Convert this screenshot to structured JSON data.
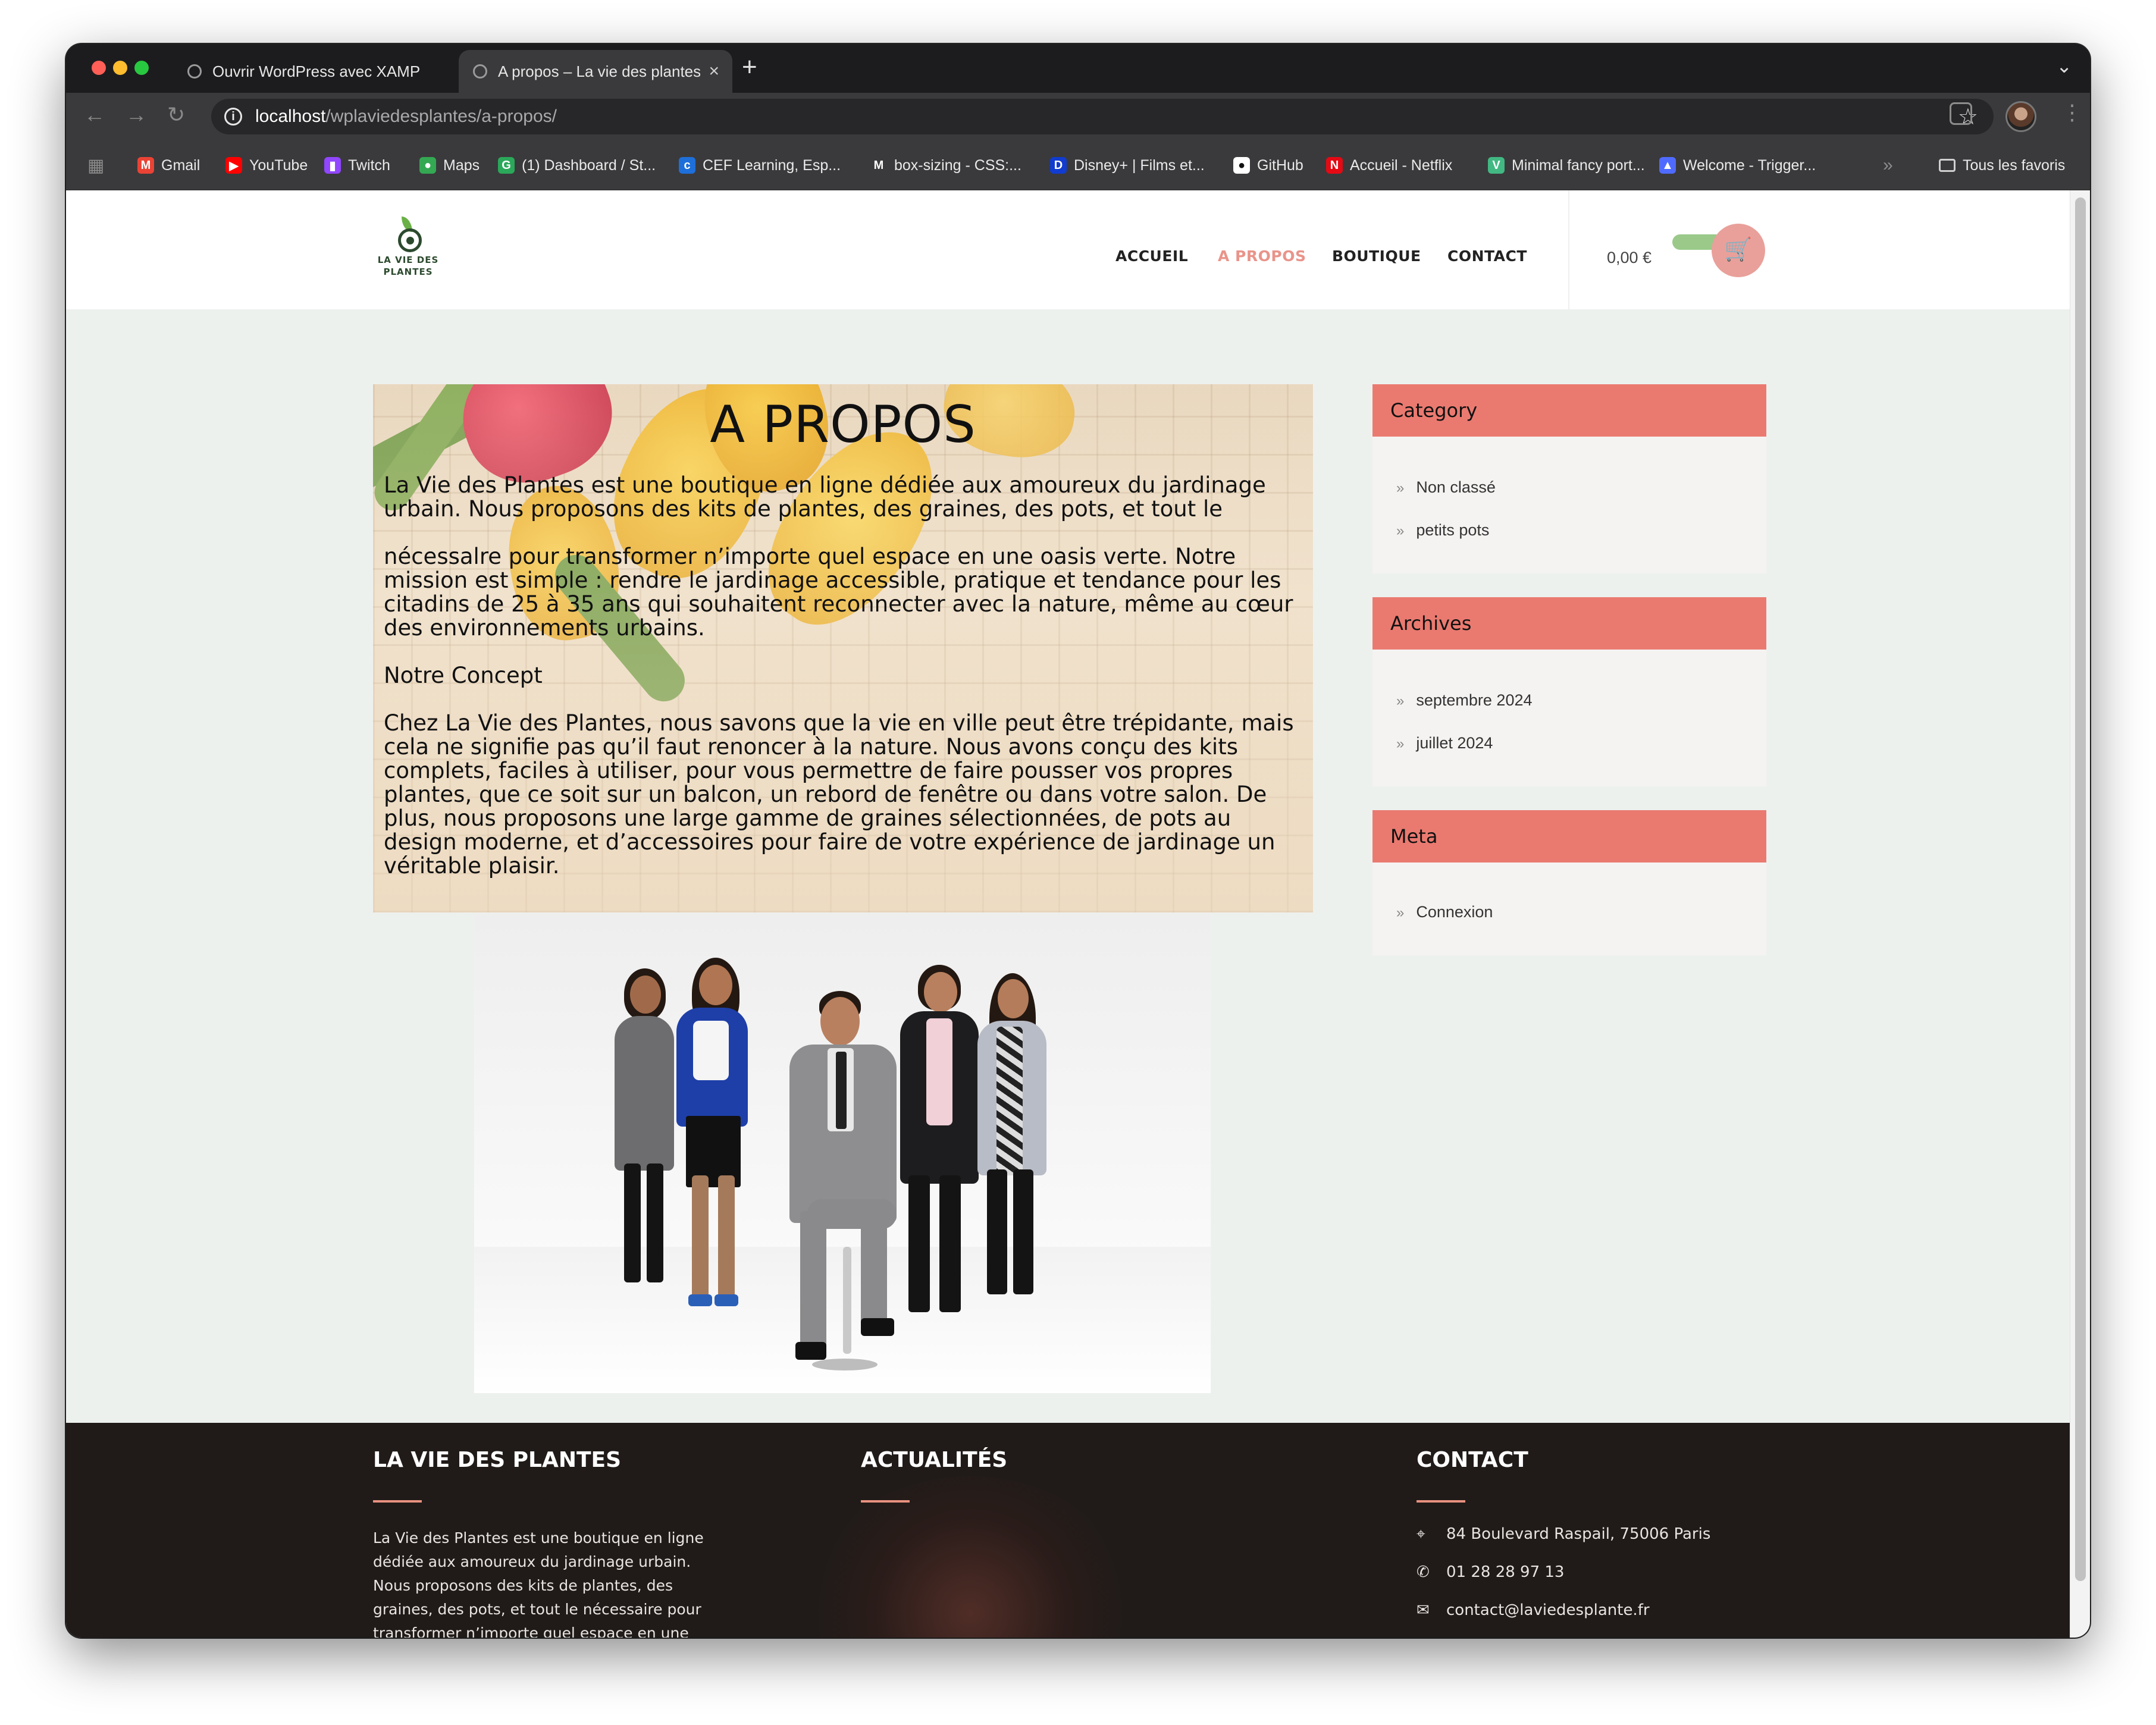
{
  "browser": {
    "tabs": [
      {
        "title": "Ouvrir WordPress avec XAMP",
        "close": "×"
      },
      {
        "title": "A propos – La vie des plantes",
        "close": "×"
      }
    ],
    "new_tab": "+",
    "tab_menu": "⌄",
    "nav": {
      "back": "←",
      "forward": "→",
      "reload": "↻"
    },
    "url": {
      "host": "localhost",
      "path": "/wplaviedesplantes/a-propos/"
    },
    "star": "☆",
    "menu": "⋮",
    "bookmarks": [
      {
        "label": "Gmail",
        "icon": "gmail-icon",
        "color": "#ea4335",
        "glyph": "M"
      },
      {
        "label": "YouTube",
        "icon": "youtube-icon",
        "color": "#ff0000",
        "glyph": "▶"
      },
      {
        "label": "Twitch",
        "icon": "twitch-icon",
        "color": "#9146ff",
        "glyph": "▮"
      },
      {
        "label": "Maps",
        "icon": "maps-icon",
        "color": "#34a853",
        "glyph": "●"
      },
      {
        "label": "(1) Dashboard / St...",
        "icon": "dashboard-icon",
        "color": "#2ba85a",
        "glyph": "G"
      },
      {
        "label": "CEF Learning, Esp...",
        "icon": "cef-icon",
        "color": "#1e6fd9",
        "glyph": "c"
      },
      {
        "label": "box-sizing - CSS:...",
        "icon": "mdn-icon",
        "color": "#3a3a3c",
        "glyph": "M"
      },
      {
        "label": "Disney+ | Films et...",
        "icon": "disney-icon",
        "color": "#113ccf",
        "glyph": "D"
      },
      {
        "label": "GitHub",
        "icon": "github-icon",
        "color": "#ffffff",
        "glyph": "●"
      },
      {
        "label": "Accueil - Netflix",
        "icon": "netflix-icon",
        "color": "#e50914",
        "glyph": "N"
      },
      {
        "label": "Minimal fancy port...",
        "icon": "vue-icon",
        "color": "#42b883",
        "glyph": "V"
      },
      {
        "label": "Welcome - Trigger...",
        "icon": "trigger-icon",
        "color": "#4f6bff",
        "glyph": "▲"
      }
    ],
    "bookmarks_overflow": "»",
    "all_bookmarks": "Tous les favoris"
  },
  "site": {
    "logo": {
      "line1": "LA VIE DES",
      "line2": "PLANTES"
    },
    "menu": [
      {
        "label": "ACCUEIL",
        "active": false
      },
      {
        "label": "A PROPOS",
        "active": true
      },
      {
        "label": "BOUTIQUE",
        "active": false
      },
      {
        "label": "CONTACT",
        "active": false
      }
    ],
    "cart_price": "0,00 €",
    "cart_icon": "🛒"
  },
  "hero": {
    "title": "A PROPOS",
    "p1": "La Vie des Plantes est une boutique en ligne dédiée aux amoureux du jardinage urbain. Nous proposons des kits de plantes, des graines, des pots, et tout le",
    "p2": "nécessalre pour transformer n’importe quel espace en une oasis verte. Notre mission est simple : rendre le jardinage accessible, pratique et tendance pour les citadins de 25 à 35 ans qui souhaitent reconnecter avec la nature, même au cœur des environnements urbains.",
    "p3": "Notre Concept",
    "p4": "Chez La Vie des Plantes, nous savons que la vie en ville peut être trépidante, mais cela ne signifie pas qu’il faut renoncer à la nature. Nous avons conçu des kits complets, faciles à utiliser, pour vous permettre de faire pousser vos propres plantes, que ce soit sur un balcon, un rebord de fenêtre ou dans votre salon. De plus, nous proposons une large gamme de graines sélectionnées, de pots au design moderne, et d’accessoires pour faire de votre expérience de jardinage un véritable plaisir."
  },
  "sidebar": {
    "category": {
      "title": "Category",
      "items": [
        "Non classé",
        "petits pots"
      ]
    },
    "archives": {
      "title": "Archives",
      "items": [
        "septembre 2024",
        "juillet 2024"
      ]
    },
    "meta": {
      "title": "Meta",
      "items": [
        "Connexion"
      ]
    },
    "chevron": "»"
  },
  "footer": {
    "col1": {
      "title": "LA VIE DES PLANTES",
      "text": "La Vie des Plantes est une boutique en ligne dédiée aux amoureux du jardinage urbain. Nous proposons des kits de plantes, des graines, des pots, et tout le nécessaire pour transformer n’importe quel espace en une oasis verte."
    },
    "col2": {
      "title": "ACTUALITÉS"
    },
    "col3": {
      "title": "CONTACT",
      "address": "84 Boulevard Raspail, 75006 Paris",
      "phone": "01 28 28 97 13",
      "email": "contact@laviedesplante.fr"
    }
  },
  "colors": {
    "accent": "#ea7a70",
    "active_menu": "#e9948a",
    "footer_bg": "#201b19",
    "page_bg": "#edf1ee"
  }
}
